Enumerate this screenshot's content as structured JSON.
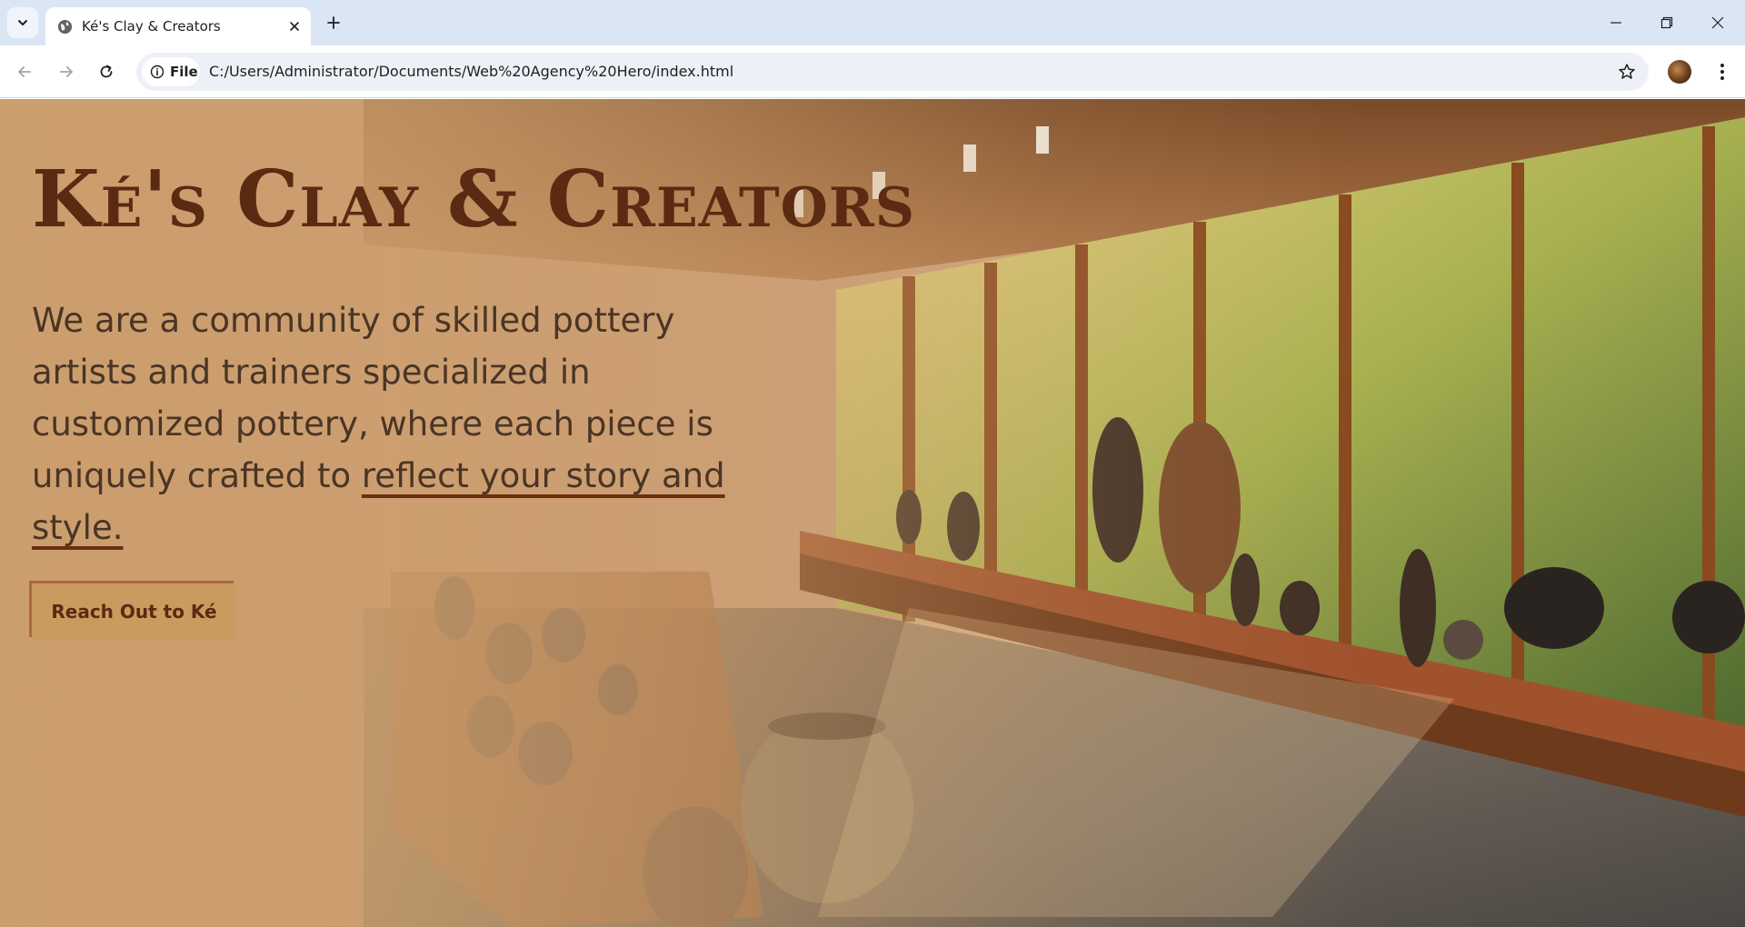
{
  "browser": {
    "tab": {
      "title": "Ké's Clay & Creators",
      "favicon": "globe-icon"
    },
    "omnibox": {
      "site_info_label": "File",
      "url": "C:/Users/Administrator/Documents/Web%20Agency%20Hero/index.html"
    },
    "icons": {
      "tab_search": "chevron-down-icon",
      "new_tab": "plus-icon",
      "back": "arrow-left-icon",
      "forward": "arrow-right-icon",
      "reload": "reload-icon",
      "site_info": "info-icon",
      "bookmark": "star-icon",
      "menu": "kebab-menu-icon",
      "minimize": "minimize-icon",
      "restore": "restore-icon",
      "close": "close-icon"
    }
  },
  "hero": {
    "title": "Ké's Clay & Creators",
    "description_plain": "We are a community of skilled pottery artists and trainers specialized in customized pottery, where each piece is uniquely crafted to",
    "description_highlight": "reflect your story and style.",
    "cta_label": "Reach Out to Ké",
    "background_image": "pottery-gallery-photo"
  },
  "colors": {
    "title": "#5a2a12",
    "text": "#4a3525",
    "cta_bg": "#c99b5e",
    "underline": "#6b2e12",
    "tabbar": "#dbe6f5"
  }
}
